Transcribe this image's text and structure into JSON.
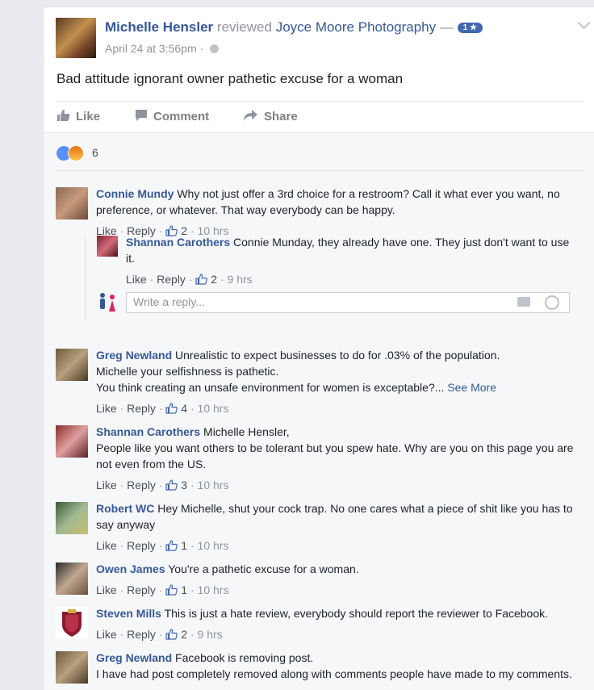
{
  "post": {
    "author": "Michelle Hensler",
    "verb": "reviewed",
    "target": "Joyce Moore Photography",
    "dash": "—",
    "rating": "1 ★",
    "timestamp": "April 24 at 3:56pm",
    "dot": "·",
    "text": "Bad attitude ignorant owner pathetic excuse for a woman",
    "actions": {
      "like": "Like",
      "comment": "Comment",
      "share": "Share"
    },
    "reaction_count": "6"
  },
  "comments": [
    {
      "author": "Connie Mundy",
      "text": "Why not just offer a 3rd choice for a restroom? Call it what ever you want, no preference, or whatever. That way everybody can be happy.",
      "like": "Like",
      "reply": "Reply",
      "likes": "2",
      "time": "10 hrs"
    },
    {
      "author": "Greg Newland",
      "text": "Unrealistic to expect businesses to do for .03% of the population.",
      "text2": "Michelle your selfishness is pathetic.",
      "text3": "You think creating an unsafe environment for women is exceptable?...",
      "see_more": "See More",
      "like": "Like",
      "reply": "Reply",
      "likes": "4",
      "time": "10 hrs"
    },
    {
      "author": "Shannan Carothers",
      "text": "Michelle Hensler,",
      "text2": "People like you want others to be tolerant but you spew hate. Why are you on this page you are not even from the US.",
      "like": "Like",
      "reply": "Reply",
      "likes": "3",
      "time": "10 hrs"
    },
    {
      "author": "Robert WC",
      "text": "Hey Michelle, shut your cock trap. No one cares what a piece of shit like you has to say anyway",
      "like": "Like",
      "reply": "Reply",
      "likes": "1",
      "time": "10 hrs"
    },
    {
      "author": "Owen James",
      "text": "You're a pathetic excuse for a woman.",
      "like": "Like",
      "reply": "Reply",
      "likes": "1",
      "time": "10 hrs"
    },
    {
      "author": "Steven Mills",
      "text": "This is just a hate review, everybody should report the reviewer to Facebook.",
      "like": "Like",
      "reply": "Reply",
      "likes": "2",
      "time": "9 hrs"
    },
    {
      "author": "Greg Newland",
      "text": "Facebook is removing post.",
      "text2": "I have had post completely removed along with comments people have made to my comments."
    }
  ],
  "reply": {
    "author": "Shannan Carothers",
    "text": "Connie Munday, they already have one. They just don't want to use it.",
    "like": "Like",
    "reply": "Reply",
    "likes": "2",
    "time": "9 hrs"
  },
  "write_reply": {
    "placeholder": "Write a reply..."
  },
  "colors": {
    "link": "#365899",
    "muted": "#90949c",
    "like_blue": "#5890ff",
    "badge": "#4267b2"
  }
}
